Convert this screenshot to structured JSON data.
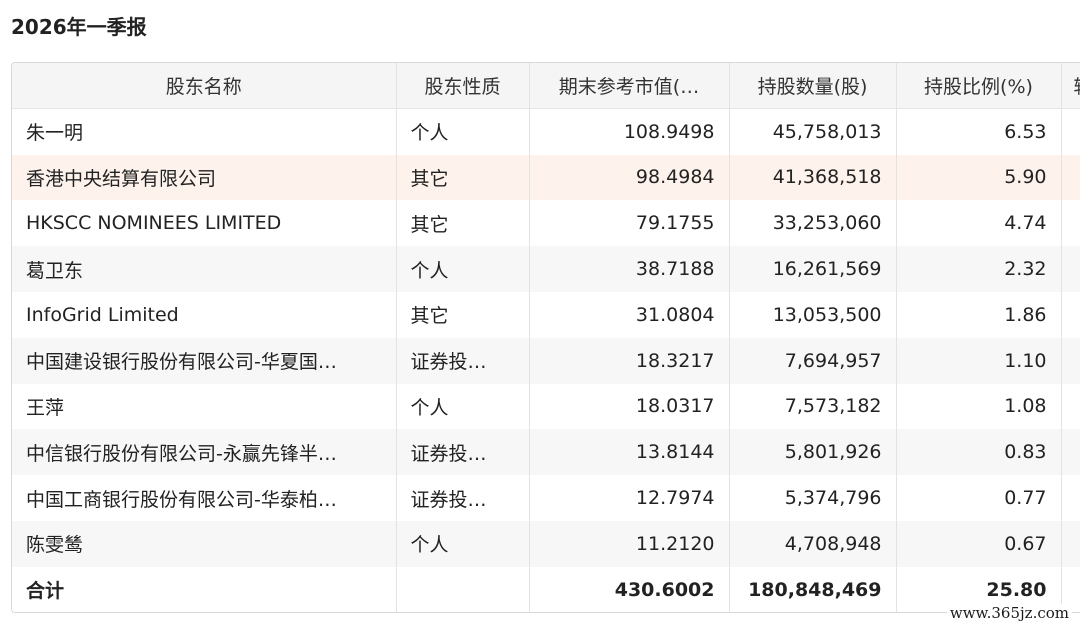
{
  "report_title": "2026年一季报",
  "columns": [
    "股东名称",
    "股东性质",
    "期末参考市值(…",
    "持股数量(股)",
    "持股比例(%)",
    "较"
  ],
  "rows": [
    {
      "name": "朱一明",
      "type": "个人",
      "market_value": "108.9498",
      "shares": "45,758,013",
      "ratio": "6.53"
    },
    {
      "name": "香港中央结算有限公司",
      "type": "其它",
      "market_value": "98.4984",
      "shares": "41,368,518",
      "ratio": "5.90"
    },
    {
      "name": "HKSCC NOMINEES LIMITED",
      "type": "其它",
      "market_value": "79.1755",
      "shares": "33,253,060",
      "ratio": "4.74"
    },
    {
      "name": "葛卫东",
      "type": "个人",
      "market_value": "38.7188",
      "shares": "16,261,569",
      "ratio": "2.32"
    },
    {
      "name": "InfoGrid Limited",
      "type": "其它",
      "market_value": "31.0804",
      "shares": "13,053,500",
      "ratio": "1.86"
    },
    {
      "name": "中国建设银行股份有限公司-华夏国…",
      "type": "证券投…",
      "market_value": "18.3217",
      "shares": "7,694,957",
      "ratio": "1.10"
    },
    {
      "name": "王萍",
      "type": "个人",
      "market_value": "18.0317",
      "shares": "7,573,182",
      "ratio": "1.08"
    },
    {
      "name": "中信银行股份有限公司-永赢先锋半…",
      "type": "证券投…",
      "market_value": "13.8144",
      "shares": "5,801,926",
      "ratio": "0.83"
    },
    {
      "name": "中国工商银行股份有限公司-华泰柏…",
      "type": "证券投…",
      "market_value": "12.7974",
      "shares": "5,374,796",
      "ratio": "0.77"
    },
    {
      "name": "陈雯鸶",
      "type": "个人",
      "market_value": "11.2120",
      "shares": "4,708,948",
      "ratio": "0.67"
    }
  ],
  "total": {
    "label": "合计",
    "type": "",
    "market_value": "430.6002",
    "shares": "180,848,469",
    "ratio": "25.80"
  },
  "highlighted_row": 1,
  "watermark": "www.365jz.com",
  "colors": {
    "header_bg": "#f5f5f5",
    "alt_row_bg": "#f7f7f7",
    "highlight_row_bg": "#fdf3ec",
    "border": "#d8d8d8"
  }
}
